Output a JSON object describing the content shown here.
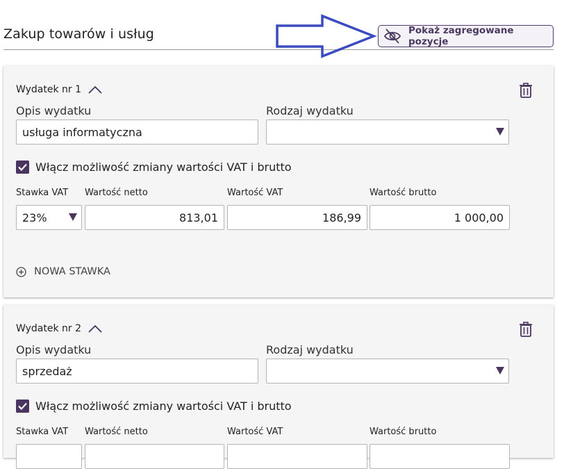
{
  "header": {
    "title": "Zakup towarów i usług",
    "agg_button_label": "Pokaż zagregowane pozycje",
    "agg_button_icon": "eye-slash-icon"
  },
  "labels": {
    "opis": "Opis wydatku",
    "rodzaj": "Rodzaj wydatku",
    "vat_toggle": "Włącz możliwość zmiany wartości VAT i brutto",
    "stawka": "Stawka VAT",
    "netto": "Wartość netto",
    "vat": "Wartość VAT",
    "brutto": "Wartość brutto",
    "nowa_stawka": "NOWA STAWKA"
  },
  "expenses": [
    {
      "title": "Wydatek nr 1",
      "opis": "usługa informatyczna",
      "rodzaj": "",
      "vat_toggle_checked": true,
      "stawka": "23%",
      "netto": "813,01",
      "vat": "186,99",
      "brutto": "1 000,00"
    },
    {
      "title": "Wydatek nr 2",
      "opis": "sprzedaż",
      "rodzaj": "",
      "vat_toggle_checked": true
    }
  ],
  "colors": {
    "accent": "#4a3460",
    "annotation_arrow": "#3b4bc0"
  }
}
